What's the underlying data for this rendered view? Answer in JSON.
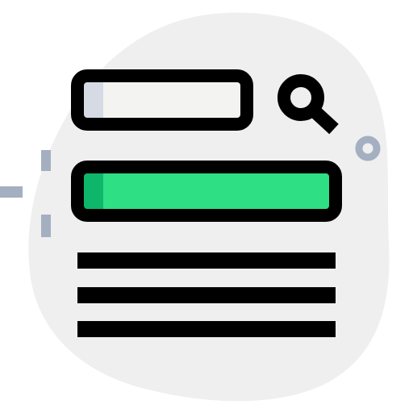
{
  "icon": {
    "name": "search-results-icon",
    "components": [
      "search-field",
      "search-icon",
      "highlighted-result",
      "result-lines"
    ]
  },
  "colors": {
    "blob_background": "#efefef",
    "outline": "#000000",
    "search_field_fill": "#f3f3f1",
    "search_field_shade": "#d5dae4",
    "highlight_fill": "#2fdf84",
    "highlight_shade": "#0eb66a",
    "decoration": "#a4afc1"
  }
}
